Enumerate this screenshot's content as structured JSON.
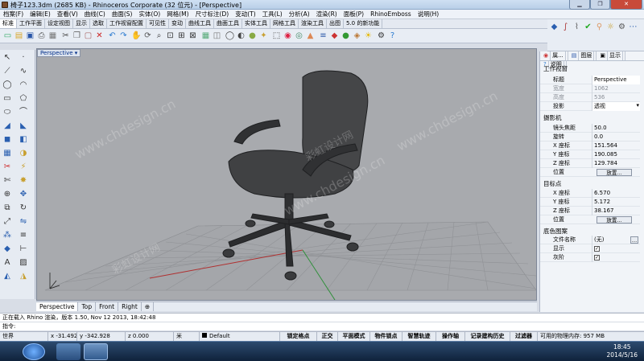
{
  "window": {
    "title": "椅子123.3dm (2685 KB) - Rhinoceros Corporate (32 位元) - [Perspective]",
    "controls": [
      "minimize",
      "maximize",
      "close"
    ]
  },
  "menu": [
    "档案(F)",
    "编辑(E)",
    "查看(V)",
    "曲线(C)",
    "曲面(S)",
    "实体(O)",
    "网格(M)",
    "尺寸标注(D)",
    "变动(T)",
    "工具(L)",
    "分析(A)",
    "渲染(R)",
    "面板(P)",
    "RhinoEmboss",
    "说明(H)"
  ],
  "toolbar_tabs": [
    "标准",
    "工作平面",
    "设定视图",
    "显示",
    "选取",
    "工作视窗配置",
    "可见性",
    "变动",
    "曲线工具",
    "曲面工具",
    "实体工具",
    "网格工具",
    "渲染工具",
    "出图",
    "5.0 的新功能"
  ],
  "toolbar_tabs_active": 0,
  "viewport": {
    "label": "Perspective",
    "tabs": [
      "Perspective",
      "Top",
      "Front",
      "Right"
    ],
    "add_tab": "⊕"
  },
  "panel": {
    "tabs": [
      "属...",
      "图层",
      "显示",
      "说明"
    ],
    "sections": {
      "viewport": "工作视窗",
      "camera": "摄影机",
      "target": "目标点",
      "background": "底色图案"
    },
    "viewport_rows": [
      {
        "label": "标题",
        "value": "Perspective",
        "muted": false
      },
      {
        "label": "宽度",
        "value": "1062",
        "muted": true
      },
      {
        "label": "高度",
        "value": "536",
        "muted": true
      },
      {
        "label": "投影",
        "value": "透视",
        "muted": false
      }
    ],
    "camera_rows": [
      {
        "label": "镜头焦距",
        "value": "50.0"
      },
      {
        "label": "旋转",
        "value": "0.0"
      },
      {
        "label": "X 座标",
        "value": "151.564"
      },
      {
        "label": "Y 座标",
        "value": "190.085"
      },
      {
        "label": "Z 座标",
        "value": "129.784"
      }
    ],
    "camera_location": {
      "label": "位置",
      "button": "放置..."
    },
    "target_rows": [
      {
        "label": "X 座标",
        "value": "6.570"
      },
      {
        "label": "Y 座标",
        "value": "5.172"
      },
      {
        "label": "Z 座标",
        "value": "38.167"
      }
    ],
    "target_location": {
      "label": "位置",
      "button": "放置..."
    },
    "bg_rows": [
      {
        "label": "文件名称",
        "value": "(无)"
      },
      {
        "label": "显示",
        "value": "✓"
      },
      {
        "label": "灰阶",
        "value": "✓"
      }
    ]
  },
  "command": {
    "history": "正在载入 Rhino 渲染，版本 1.50, Nov 12 2013, 18:42:48",
    "prompt": "指令:"
  },
  "status": {
    "cplane": "世界",
    "x": "x -31.492",
    "y": "y -342.928",
    "z": "z 0.000",
    "units": "米",
    "layer": "Default",
    "snap_toggles": [
      "锁定格点",
      "正交",
      "平面模式",
      "物件锁点",
      "智慧轨迹",
      "操作轴",
      "记录建构历史",
      "过滤器"
    ],
    "memory": "可用的物理内存: 957 MB"
  },
  "taskbar": {
    "time": "18:45",
    "date": "2014/5/16"
  },
  "watermark": [
    "www.chdesign.cn",
    "彩虹设计网"
  ],
  "colors": {
    "viewport_bg": "#a8aaae",
    "grid": "#8e9094",
    "x_axis": "#b03030",
    "y_axis": "#2f8f3a",
    "chair": "#3a3b3d"
  }
}
